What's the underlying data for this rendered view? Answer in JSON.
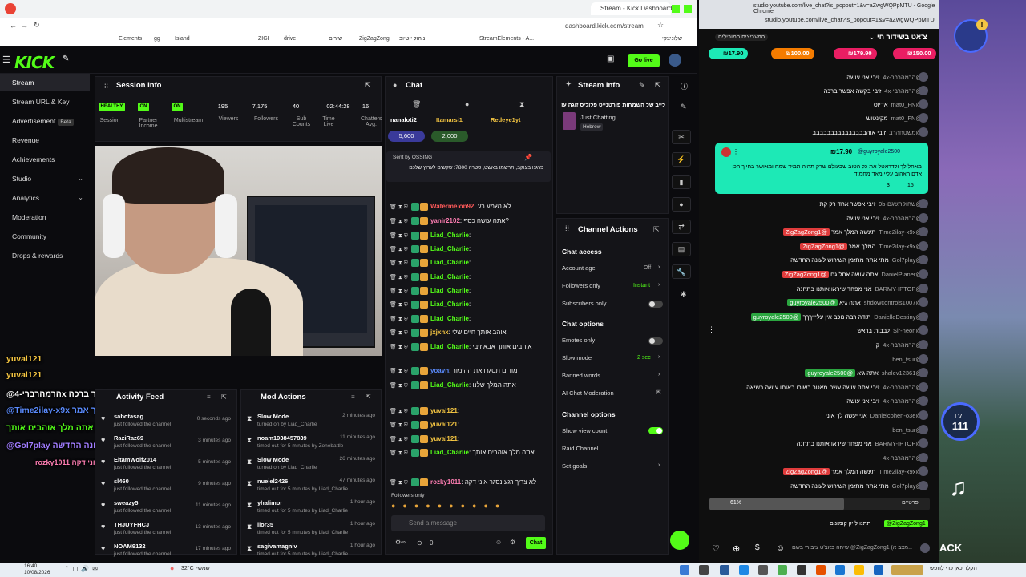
{
  "browser": {
    "left_tabs": [
      "Stream - Kick Dashboard"
    ],
    "url": "dashboard.kick.com/stream",
    "bookmarks": [
      "Elements",
      "gg",
      "Island",
      "ZIGI",
      "drive",
      "שירים",
      "ZigZagZong",
      "ניהול יוטיוב",
      "StreamElements - A...",
      "שלוניצקי"
    ]
  },
  "kick": {
    "logo": "KICK",
    "go_live": "Go live",
    "sidebar": [
      {
        "label": "Stream",
        "active": true
      },
      {
        "label": "Stream URL & Key"
      },
      {
        "label": "Advertisement",
        "badge": "Beta"
      },
      {
        "label": "Revenue"
      },
      {
        "label": "Achievements"
      },
      {
        "label": "Studio",
        "chevron": true
      },
      {
        "label": "Analytics",
        "chevron": true
      },
      {
        "label": "Moderation"
      },
      {
        "label": "Community"
      },
      {
        "label": "Drops & rewards"
      }
    ],
    "session_info": {
      "title": "Session Info",
      "stats": [
        {
          "pill": "HEALTHY",
          "label": "Session"
        },
        {
          "pill": "ON",
          "label": "Partner Income"
        },
        {
          "pill": "ON",
          "label": "Multistream"
        },
        {
          "value": "195",
          "label": "Viewers"
        },
        {
          "value": "7,175",
          "label": "Followers"
        },
        {
          "value": "40",
          "label": "Sub Counts"
        },
        {
          "value": "02:44:28",
          "label": "Time Live"
        },
        {
          "value": "16",
          "label": "Chatters Avg."
        }
      ]
    },
    "overlay_chat": [
      {
        "text": "yuval121",
        "color": "#f4c542"
      },
      {
        "text": "yuval121",
        "color": "#f4c542"
      },
      {
        "text": "@הרמהרברי-4x זיבי בקשה אפשר ברכה",
        "color": "#ffffff"
      },
      {
        "text": "@Time2ilay-x9x תעשה המלך אמר @ZigZagZong1",
        "color": "#5b8cff"
      },
      {
        "text": "אתה מלך אוהבים אותך Liad_Charlie",
        "color": "#53fc18"
      },
      {
        "text": "@Gol7play מתי אתה מתזמן השירוש לעונה החדשה",
        "color": "#a07cff"
      },
      {
        "text": "rozky1011 בעולם לא צריך אוני דקה",
        "color": "#ff7eb3"
      }
    ],
    "activity_feed": {
      "title": "Activity Feed",
      "rows": [
        {
          "name": "sabotasag",
          "sub": "just followed the channel",
          "time": "0 seconds ago"
        },
        {
          "name": "RaziRaz69",
          "sub": "just followed the channel",
          "time": "3 minutes ago"
        },
        {
          "name": "EitamWolf2014",
          "sub": "just followed the channel",
          "time": "5 minutes ago"
        },
        {
          "name": "sl460",
          "sub": "just followed the channel",
          "time": "9 minutes ago"
        },
        {
          "name": "sweazy5",
          "sub": "just followed the channel",
          "time": "11 minutes ago"
        },
        {
          "name": "THJUYFHCJ",
          "sub": "just followed the channel",
          "time": "13 minutes ago"
        },
        {
          "name": "NOAM9132",
          "sub": "just followed the channel",
          "time": "17 minutes ago"
        }
      ]
    },
    "mod_actions": {
      "title": "Mod Actions",
      "rows": [
        {
          "name": "Slow Mode",
          "sub": "turned on by Liad_Charlie",
          "time": "2 minutes ago"
        },
        {
          "name": "noam1938457839",
          "sub": "timed out for 5 minutes by Zonebattle",
          "time": "11 minutes ago"
        },
        {
          "name": "Slow Mode",
          "sub": "turned on by Liad_Charlie",
          "time": "26 minutes ago"
        },
        {
          "name": "nueiel2426",
          "sub": "timed out for 5 minutes by Liad_Charlie",
          "time": "47 minutes ago"
        },
        {
          "name": "yhalimor",
          "sub": "timed out for 5 minutes by Liad_Charlie",
          "time": "1 hour ago"
        },
        {
          "name": "lior35",
          "sub": "timed out for 5 minutes by Liad_Charlie",
          "time": "1 hour ago"
        },
        {
          "name": "sagivamagniv",
          "sub": "timed out for 5 minutes by Liad_Charlie",
          "time": "1 hour ago"
        }
      ]
    },
    "chat": {
      "title": "Chat",
      "top_users": [
        "nanaloti2",
        "Itamarsi1",
        "Redeye1yt"
      ],
      "gift_values": [
        "5,600",
        "2,000"
      ],
      "pinned_by": "Sent by OSSING",
      "pinned_text": "פרגנו בעוקב, תרשמו באשט, סטרה 7800: שקשים לערוץ שלכם",
      "lines": [
        {
          "name": "Watermelon92",
          "msg": "לא נשמע רע",
          "color": "#ff5a5a"
        },
        {
          "name": "yanir2102",
          "msg": "אתה עושה כסף?",
          "color": "#ff7eb3"
        },
        {
          "name": "Liad_Charlie",
          "msg": "",
          "color": "#53fc18"
        },
        {
          "name": "Liad_Charlie",
          "msg": "",
          "color": "#53fc18"
        },
        {
          "name": "Liad_Charlie",
          "msg": "",
          "color": "#53fc18"
        },
        {
          "name": "Liad_Charlie",
          "msg": "",
          "color": "#53fc18"
        },
        {
          "name": "Liad_Charlie",
          "msg": "",
          "color": "#53fc18"
        },
        {
          "name": "Liad_Charlie",
          "msg": "",
          "color": "#53fc18"
        },
        {
          "name": "Liad_Charlie",
          "msg": "",
          "color": "#53fc18"
        },
        {
          "name": "jxjxnx",
          "msg": "אוהב אותך חיים שלי",
          "color": "#f4c542"
        },
        {
          "name": "Liad_Charlie",
          "msg": "אוהבים אותך אבא זיבי",
          "color": "#53fc18"
        },
        {
          "name": "yoavn",
          "msg": "מודים תסגרו את ההימור",
          "color": "#5b8cff"
        },
        {
          "name": "Liad_Charlie",
          "msg": "אתה המלך שלנו",
          "color": "#53fc18"
        },
        {
          "name": "yuval121",
          "msg": "",
          "color": "#f4c542"
        },
        {
          "name": "yuval121",
          "msg": "",
          "color": "#f4c542"
        },
        {
          "name": "yuval121",
          "msg": "",
          "color": "#f4c542"
        },
        {
          "name": "Liad_Charlie",
          "msg": "אתה מלך אוהבים אותך",
          "color": "#53fc18"
        },
        {
          "name": "rozky1011",
          "msg": "לא צריך רגע נסגר אוני דקה",
          "color": "#ff7eb3"
        }
      ],
      "followers_only": "Followers only",
      "send_placeholder": "Send a message",
      "send_button": "Chat",
      "count": "0"
    },
    "stream_info": {
      "title": "Stream info",
      "stream_title": "לייב של השמחות פורטנייט פלוליס זוגה עוד",
      "category": "Just Chatting",
      "language": "Hebrew"
    },
    "channel_actions": {
      "title": "Channel Actions",
      "chat_access": "Chat access",
      "account_age": {
        "label": "Account age",
        "value": "Off"
      },
      "followers_only": {
        "label": "Followers only",
        "value": "Instant"
      },
      "subscribers_only": {
        "label": "Subscribers only"
      },
      "chat_options": "Chat options",
      "emotes_only": {
        "label": "Emotes only"
      },
      "slow_mode": {
        "label": "Slow mode",
        "value": "2 sec"
      },
      "banned_words": "Banned words",
      "ai_moderation": "AI Chat Moderation",
      "channel_options": "Channel options",
      "show_view_count": "Show view count",
      "raid_channel": "Raid Channel",
      "set_goals": "Set goals"
    }
  },
  "youtube": {
    "url_title": "studio.youtube.com/live_chat?is_popout=1&v=aZwgWQPpMTU - Google Chrome",
    "url": "studio.youtube.com/live_chat?is_popout=1&v=aZwgWQPpMTU",
    "chat_title": "צ'אט בשידור חי",
    "top_fans": "המעריצים המובילים",
    "superchat_chips": [
      {
        "value": "₪17.90",
        "color": "#1de9b6"
      },
      {
        "value": "₪100.00",
        "color": "#f57c00"
      },
      {
        "value": "₪179.90",
        "color": "#e91e63"
      },
      {
        "value": "₪150.00",
        "color": "#e91e63"
      }
    ],
    "messages_top": [
      {
        "name": "@הרמהרבר-4x",
        "msg": "זיבי אני עושה"
      },
      {
        "name": "@הרמהרבי-4x",
        "msg": "זיבי בקשה אפשר ברכה"
      },
      {
        "name": "@mat0_FN",
        "msg": "אדיוס"
      },
      {
        "name": "@mat0_FN",
        "msg": "מקינטוש"
      },
      {
        "name": "@משטחהרב",
        "msg": "זיבי אוהבבבבבבבבבבבבבבב"
      }
    ],
    "superchat": {
      "amount": "₪17.90",
      "user": "@guyroyale2500",
      "text": "מאחל לך ולדראטל את כל הטוב שבעולם שרק תהיה תמיד שמח ומאושר בחייך הכן אדם האהוב עליי מאד מחמוד",
      "likes": "15",
      "replies": "3"
    },
    "messages_bottom": [
      {
        "name": "@שחוקתשגם-9b",
        "msg": "זיבי אפשר אחד רק קת",
        "mention": ""
      },
      {
        "name": "@הרמהרבר-4x",
        "msg": "זיבי אני עושה",
        "mention": ""
      },
      {
        "name": "@Time2ilay-x9x",
        "msg": "תעשה המלך אמר",
        "mention": "@ZigZagZong1"
      },
      {
        "name": "@Time2ilay-x9x",
        "msg": "המלך אמר",
        "mention": "@ZigZagZong1"
      },
      {
        "name": "@Gol7play",
        "msg": "מתי אתה מתזמן השירוש לעונה החדשה",
        "mention": ""
      },
      {
        "name": "@DanielPlaner",
        "msg": "אתה עושה אסל גם",
        "mention": "@ZigZagZong1"
      },
      {
        "name": "@BARMY-IPTOP",
        "msg": "אני מפחד שיראו אותנו בתחנה",
        "mention": ""
      },
      {
        "name": "@shdowcontrols1007",
        "msg": "אתה גיא",
        "mention": "@guyroyale2500"
      },
      {
        "name": "@DanielleDestiny",
        "msg": "תודה רבה נוכב אין עליייךךך",
        "mention": "@guyroyale2500"
      },
      {
        "name": "@Sir-neon",
        "msg": "לבבות בראש",
        "mention": ""
      },
      {
        "name": "@הרמהרבר-4x",
        "msg": "ק",
        "mention": ""
      },
      {
        "name": "@ben_tsur",
        "msg": "",
        "mention": ""
      },
      {
        "name": "@shalev12361",
        "msg": "אתה גיא",
        "mention": "@guyroyale2500"
      },
      {
        "name": "@הרמהרבר-4x",
        "msg": "זיבי אתה עושה עשה מאטר בשובו באותו עושה בשיאה",
        "mention": ""
      },
      {
        "name": "@הרמהרבר-4x",
        "msg": "זיבי אני עושה",
        "mention": ""
      },
      {
        "name": "@Danielcohen-o3e",
        "msg": "אני יעשה לך אוני",
        "mention": ""
      },
      {
        "name": "@ben_tsur",
        "msg": "",
        "mention": ""
      },
      {
        "name": "@BARMY-IPTOP",
        "msg": "אני מפחד שיראו אותנו בתחנה",
        "mention": ""
      },
      {
        "name": "@הרמהרבר-4x",
        "msg": "",
        "mention": ""
      },
      {
        "name": "@Time2ilay-x9x",
        "msg": "תעשה המלך אמר",
        "mention": "@ZigZagZong1"
      },
      {
        "name": "@Gol7play",
        "msg": "מתי אתה מתזמן השירוש לעונה החדשה",
        "mention": ""
      }
    ],
    "poll_progress": "61%",
    "poll_label": "פרטיים",
    "pinned_mention": "@ZigZagZong1",
    "pinned_msg": "תתנו לייק קומונים",
    "input_placeholder": "שיחה באצ'ט ציבורי בשם @ZigZagZong1 (מצב א...",
    "game_level_label": "LVL",
    "game_level": "111",
    "game_text": "ACK"
  },
  "taskbar": {
    "time": "16:40",
    "date": "10/08/2026",
    "weather": "32°C",
    "weather_desc": "שמשי",
    "search": "הקלד כאן כדי לחפש"
  }
}
